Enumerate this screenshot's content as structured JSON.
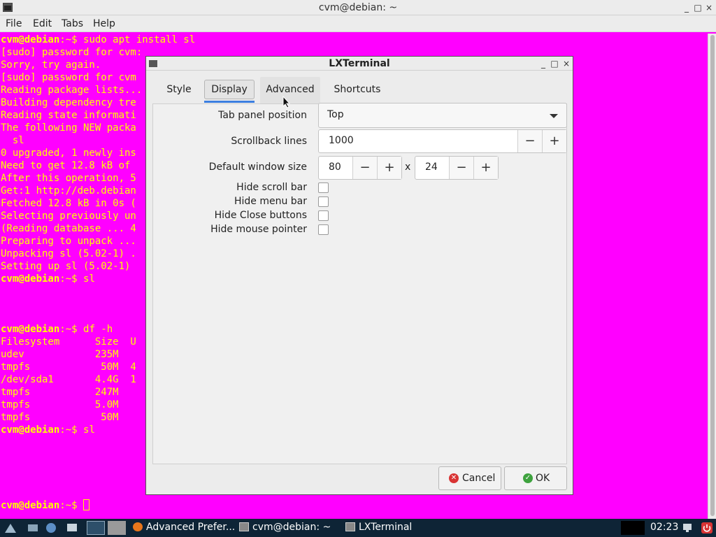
{
  "window": {
    "title": "cvm@debian: ~",
    "controls": [
      "_",
      "□",
      "×"
    ]
  },
  "menubar": [
    "File",
    "Edit",
    "Tabs",
    "Help"
  ],
  "terminal": {
    "lines": [
      {
        "prompt": "cvm@debian",
        "rest": ":~$ sudo apt install sl"
      },
      {
        "text": "[sudo] password for cvm:"
      },
      {
        "text": "Sorry, try again."
      },
      {
        "text": "[sudo] password for cvm"
      },
      {
        "text": "Reading package lists..."
      },
      {
        "text": "Building dependency tre"
      },
      {
        "text": "Reading state informati"
      },
      {
        "text": "The following NEW packa"
      },
      {
        "text": "  sl"
      },
      {
        "text": "0 upgraded, 1 newly ins"
      },
      {
        "text": "Need to get 12.8 kB of"
      },
      {
        "text": "After this operation, 5"
      },
      {
        "text": "Get:1 http://deb.debian"
      },
      {
        "text": "Fetched 12.8 kB in 0s ("
      },
      {
        "text": "Selecting previously un"
      },
      {
        "text": "(Reading database ... 4"
      },
      {
        "text": "Preparing to unpack ..."
      },
      {
        "text": "Unpacking sl (5.02-1) ."
      },
      {
        "text": "Setting up sl (5.02-1)"
      },
      {
        "prompt": "cvm@debian",
        "rest": ":~$ sl"
      },
      {
        "text": ""
      },
      {
        "text": ""
      },
      {
        "text": ""
      },
      {
        "prompt": "cvm@debian",
        "rest": ":~$ df -h"
      },
      {
        "text": "Filesystem      Size  U"
      },
      {
        "text": "udev            235M"
      },
      {
        "text": "tmpfs            50M  4"
      },
      {
        "text": "/dev/sda1       4.4G  1"
      },
      {
        "text": "tmpfs           247M"
      },
      {
        "text": "tmpfs           5.0M"
      },
      {
        "text": "tmpfs            50M"
      },
      {
        "prompt": "cvm@debian",
        "rest": ":~$ sl"
      },
      {
        "text": ""
      },
      {
        "text": ""
      },
      {
        "text": ""
      },
      {
        "text": ""
      },
      {
        "text": ""
      },
      {
        "prompt": "cvm@debian",
        "rest": ":~$ ",
        "cursor": true
      }
    ]
  },
  "dialog": {
    "title": "LXTerminal",
    "controls": [
      "_",
      "□",
      "×"
    ],
    "tabs": [
      {
        "label": "Style"
      },
      {
        "label": "Display",
        "active": true
      },
      {
        "label": "Advanced"
      },
      {
        "label": "Shortcuts"
      }
    ],
    "tab_panel_position": {
      "label": "Tab panel position",
      "value": "Top"
    },
    "scrollback": {
      "label": "Scrollback lines",
      "value": "1000"
    },
    "window_size": {
      "label": "Default window size",
      "cols": "80",
      "rows": "24",
      "separator": "x"
    },
    "checkboxes": [
      {
        "label": "Hide scroll bar",
        "checked": false
      },
      {
        "label": "Hide menu bar",
        "checked": false
      },
      {
        "label": "Hide Close buttons",
        "checked": false
      },
      {
        "label": "Hide mouse pointer",
        "checked": false
      }
    ],
    "minus": "−",
    "plus": "+",
    "cancel_label": "Cancel",
    "ok_label": "OK"
  },
  "taskbar": {
    "tasks": [
      {
        "label": "Advanced Prefer...",
        "icon": "firefox-icon"
      },
      {
        "label": "cvm@debian: ~",
        "icon": "terminal-icon"
      },
      {
        "label": "LXTerminal",
        "icon": "terminal-icon"
      }
    ],
    "clock": "02:23"
  },
  "colors": {
    "terminal_bg": "#ff00ff",
    "terminal_fg": "#ffff00",
    "taskbar_bg": "#0e2436",
    "accent": "#3b7ee0"
  }
}
